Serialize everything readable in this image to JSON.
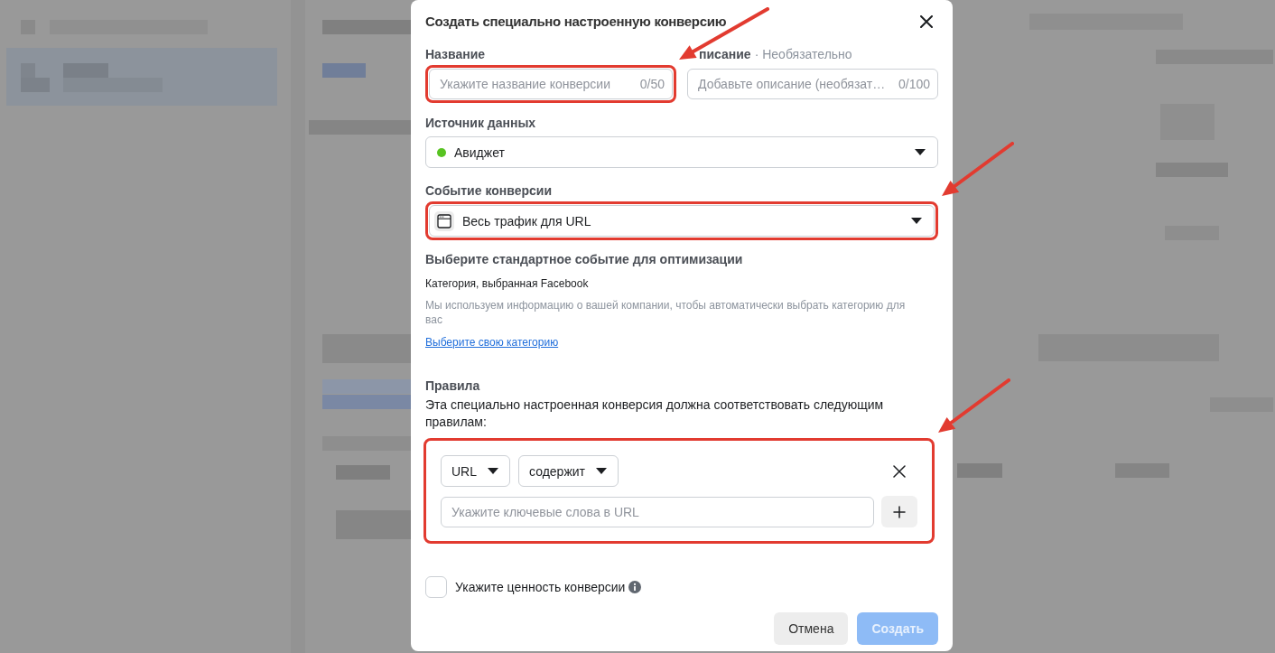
{
  "dialog": {
    "title": "Создать специально настроенную конверсию",
    "name_field": {
      "label": "Название",
      "placeholder": "Укажите название конверсии",
      "counter": "0/50",
      "highlighted": true
    },
    "description_field": {
      "label": "писание",
      "note": "· Необязательно",
      "placeholder": "Добавьте описание (необязат…",
      "counter": "0/100"
    },
    "data_source": {
      "label": "Источник данных",
      "value": "Авиджет"
    },
    "conversion_event": {
      "label": "Событие конверсии",
      "value": "Весь трафик для URL",
      "highlighted": true
    },
    "optimization": {
      "heading": "Выберите стандартное событие для оптимизации",
      "category": "Категория, выбранная Facebook",
      "hint": "Мы используем информацию о вашей компании, чтобы автоматически выбрать категорию для вас",
      "link": "Выберите свою категорию"
    },
    "rules": {
      "heading": "Правила",
      "description": "Эта специально настроенная конверсия должна соответствовать следующим правилам:",
      "highlighted": true,
      "conditions": [
        {
          "field": "URL",
          "operator": "содержит",
          "placeholder": "Укажите ключевые слова в URL"
        }
      ]
    },
    "value_checkbox": {
      "label": "Укажите ценность конверсии",
      "checked": false
    },
    "buttons": [
      {
        "label": "Отмена",
        "kind": "secondary",
        "disabled": false
      },
      {
        "label": "Создать",
        "kind": "primary",
        "disabled": true
      }
    ]
  }
}
